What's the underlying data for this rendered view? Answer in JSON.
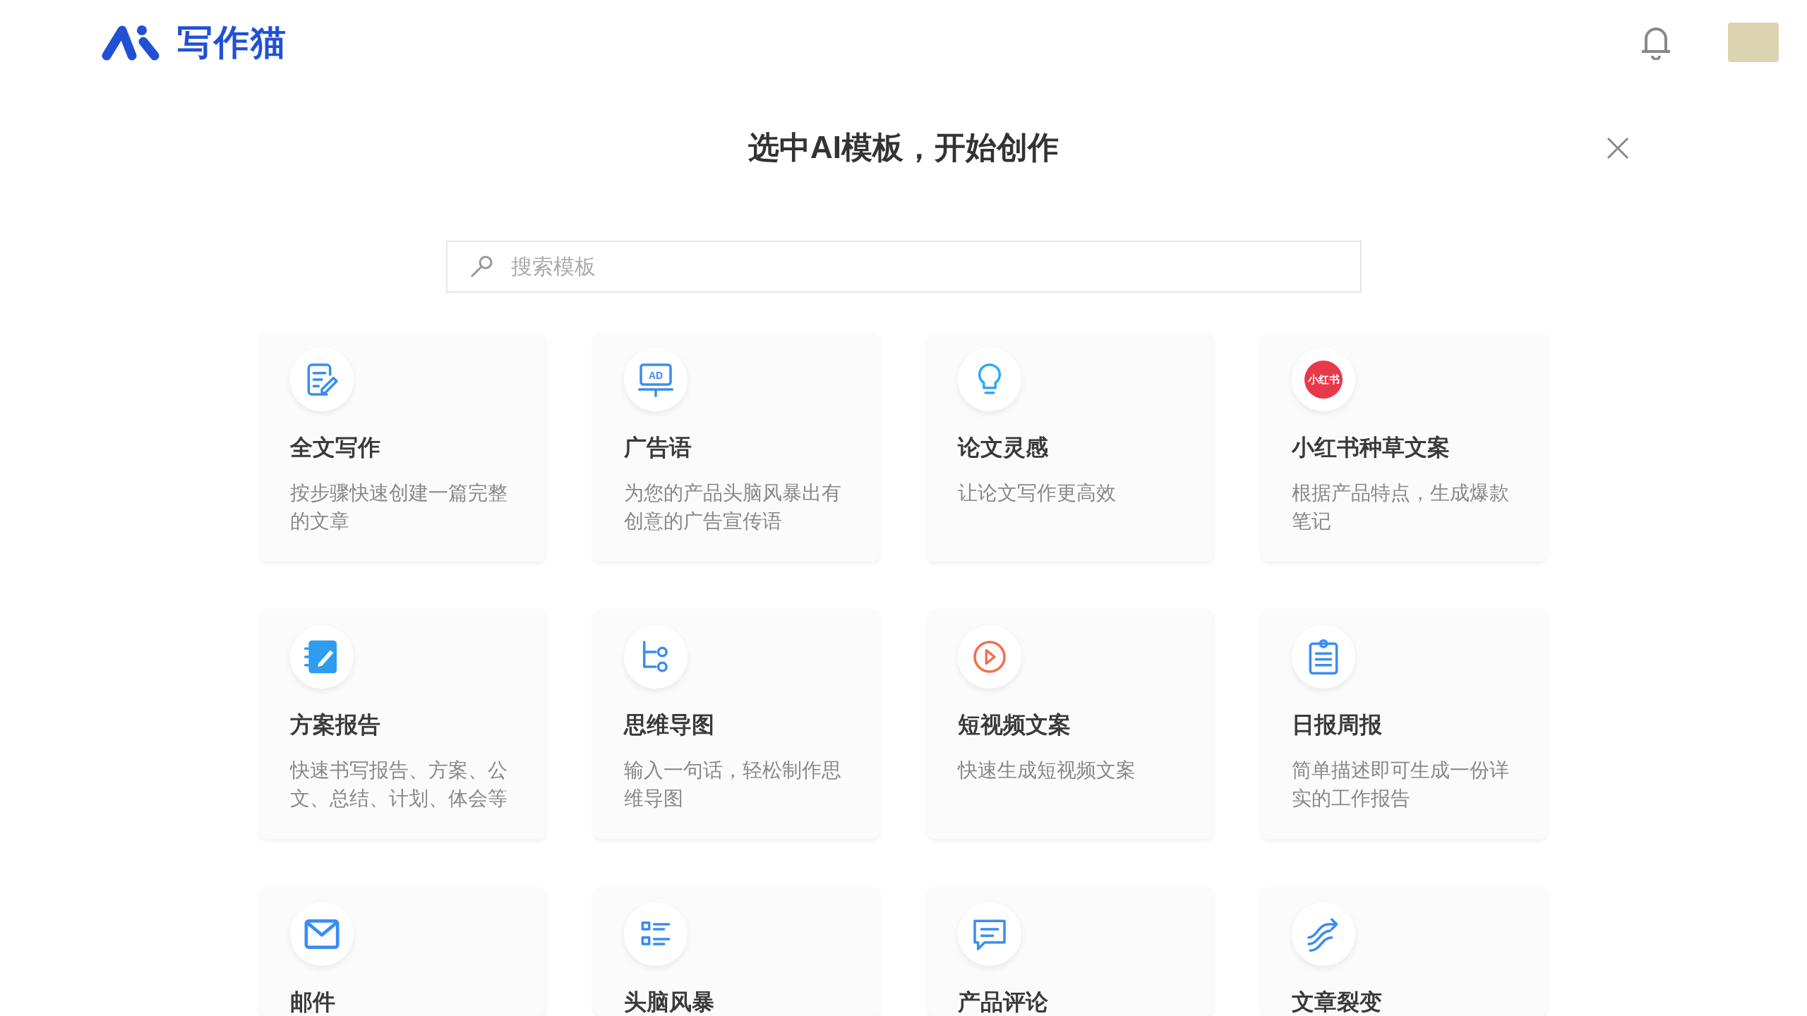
{
  "header": {
    "logo_text": "写作猫"
  },
  "title": "选中AI模板，开始创作",
  "search": {
    "placeholder": "搜索模板"
  },
  "templates": [
    {
      "kind": "doc-edit",
      "title": "全文写作",
      "description": "按步骤快速创建一篇完整的文章"
    },
    {
      "kind": "ad-board",
      "icon_text": "AD",
      "title": "广告语",
      "description": "为您的产品头脑风暴出有创意的广告宣传语"
    },
    {
      "kind": "bulb",
      "title": "论文灵感",
      "description": "让论文写作更高效"
    },
    {
      "kind": "red-badge",
      "icon_text": "小红书",
      "title": "小红书种草文案",
      "description": "根据产品特点，生成爆款笔记"
    },
    {
      "kind": "notebook",
      "title": "方案报告",
      "description": "快速书写报告、方案、公文、总结、计划、体会等"
    },
    {
      "kind": "mindmap",
      "title": "思维导图",
      "description": "输入一句话，轻松制作思维导图"
    },
    {
      "kind": "play",
      "title": "短视频文案",
      "description": "快速生成短视频文案"
    },
    {
      "kind": "clipboard",
      "title": "日报周报",
      "description": "简单描述即可生成一份详实的工作报告"
    },
    {
      "kind": "mail",
      "title": "邮件"
    },
    {
      "kind": "list",
      "title": "头脑风暴"
    },
    {
      "kind": "chat",
      "title": "产品评论"
    },
    {
      "kind": "swirl",
      "title": "文章裂变"
    }
  ]
}
